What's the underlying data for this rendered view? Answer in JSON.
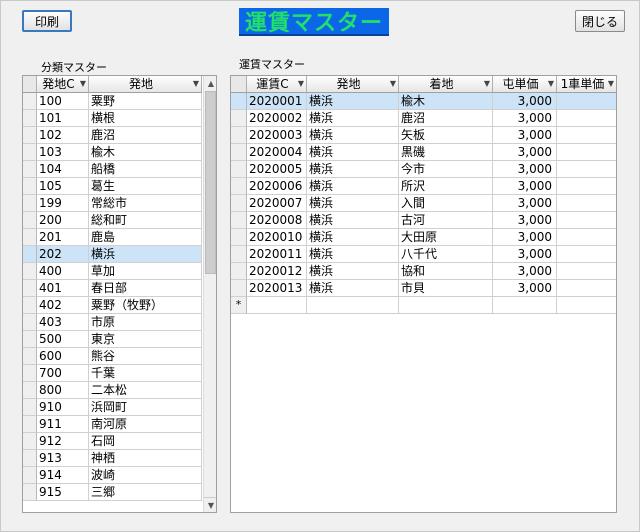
{
  "toolbar": {
    "print_label": "印刷",
    "close_label": "閉じる"
  },
  "title": "運賃マスター",
  "left_grid": {
    "caption": "分類マスター",
    "columns": [
      "発地C",
      "発地"
    ],
    "selected_index": 9,
    "rows": [
      [
        "100",
        "粟野"
      ],
      [
        "101",
        "横根"
      ],
      [
        "102",
        "鹿沼"
      ],
      [
        "103",
        "楡木"
      ],
      [
        "104",
        "船橋"
      ],
      [
        "105",
        "葛生"
      ],
      [
        "199",
        "常総市"
      ],
      [
        "200",
        "総和町"
      ],
      [
        "201",
        "鹿島"
      ],
      [
        "202",
        "横浜"
      ],
      [
        "400",
        "草加"
      ],
      [
        "401",
        "春日部"
      ],
      [
        "402",
        "粟野（牧野）"
      ],
      [
        "403",
        "市原"
      ],
      [
        "500",
        "東京"
      ],
      [
        "600",
        "熊谷"
      ],
      [
        "700",
        "千葉"
      ],
      [
        "800",
        "二本松"
      ],
      [
        "910",
        "浜岡町"
      ],
      [
        "911",
        "南河原"
      ],
      [
        "912",
        "石岡"
      ],
      [
        "913",
        "神栖"
      ],
      [
        "914",
        "波崎"
      ],
      [
        "915",
        "三郷"
      ]
    ]
  },
  "right_grid": {
    "caption": "運賃マスター",
    "columns": [
      "運賃C",
      "発地",
      "着地",
      "屯単価",
      "1車単価"
    ],
    "selected_index": 0,
    "rows": [
      [
        "2020001",
        "横浜",
        "楡木",
        "3,000",
        ""
      ],
      [
        "2020002",
        "横浜",
        "鹿沼",
        "3,000",
        ""
      ],
      [
        "2020003",
        "横浜",
        "矢板",
        "3,000",
        ""
      ],
      [
        "2020004",
        "横浜",
        "黒磯",
        "3,000",
        ""
      ],
      [
        "2020005",
        "横浜",
        "今市",
        "3,000",
        ""
      ],
      [
        "2020006",
        "横浜",
        "所沢",
        "3,000",
        ""
      ],
      [
        "2020007",
        "横浜",
        "入間",
        "3,000",
        ""
      ],
      [
        "2020008",
        "横浜",
        "古河",
        "3,000",
        ""
      ],
      [
        "2020010",
        "横浜",
        "大田原",
        "3,000",
        ""
      ],
      [
        "2020011",
        "横浜",
        "八千代",
        "3,000",
        ""
      ],
      [
        "2020012",
        "横浜",
        "協和",
        "3,000",
        ""
      ],
      [
        "2020013",
        "横浜",
        "市貝",
        "3,000",
        ""
      ]
    ],
    "new_row_marker": "*"
  },
  "colors": {
    "title_bg": "#0b67e8",
    "title_text": "#20e06a",
    "selection": "#cde3f7"
  }
}
